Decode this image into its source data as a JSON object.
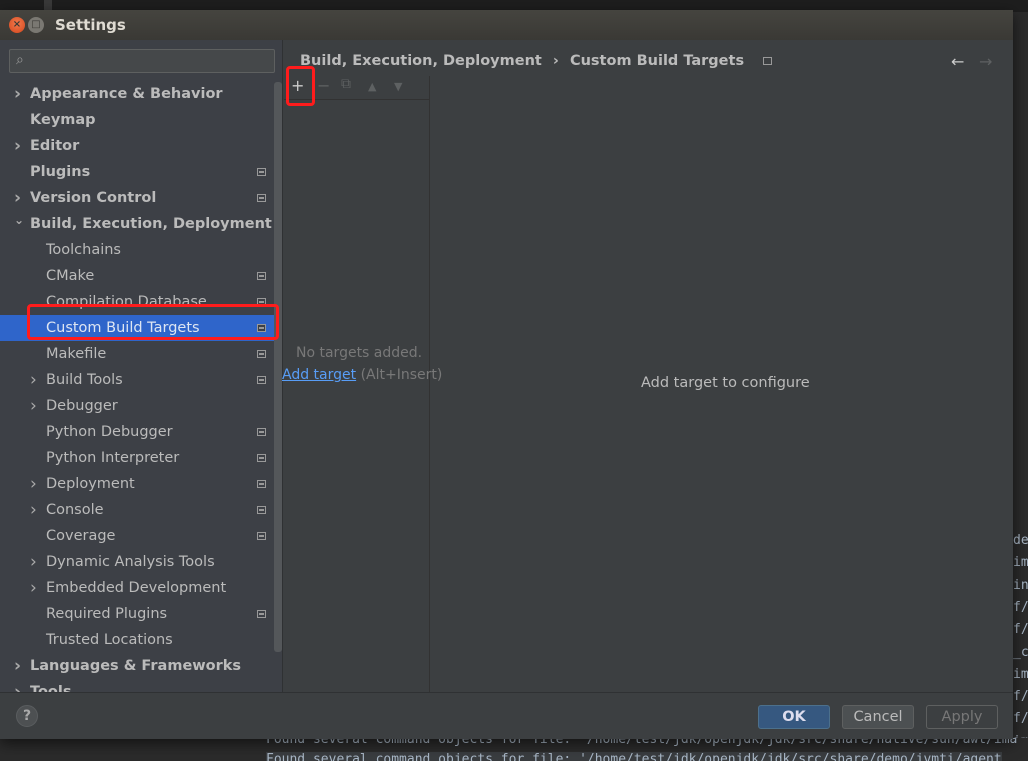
{
  "window": {
    "title": "Settings"
  },
  "search": {
    "placeholder": ""
  },
  "tree": [
    {
      "label": "Appearance & Behavior",
      "level": 0,
      "chevron": "right",
      "bold": true,
      "icon": false
    },
    {
      "label": "Keymap",
      "level": 0,
      "chevron": "none",
      "bold": true,
      "icon": false
    },
    {
      "label": "Editor",
      "level": 0,
      "chevron": "right",
      "bold": true,
      "icon": false
    },
    {
      "label": "Plugins",
      "level": 0,
      "chevron": "none",
      "bold": true,
      "icon": true
    },
    {
      "label": "Version Control",
      "level": 0,
      "chevron": "right",
      "bold": true,
      "icon": true
    },
    {
      "label": "Build, Execution, Deployment",
      "level": 0,
      "chevron": "down",
      "bold": true,
      "icon": false
    },
    {
      "label": "Toolchains",
      "level": 1,
      "chevron": "none",
      "icon": false
    },
    {
      "label": "CMake",
      "level": 1,
      "chevron": "none",
      "icon": true
    },
    {
      "label": "Compilation Database",
      "level": 1,
      "chevron": "none",
      "icon": true
    },
    {
      "label": "Custom Build Targets",
      "level": 1,
      "chevron": "none",
      "icon": true,
      "selected": true
    },
    {
      "label": "Makefile",
      "level": 1,
      "chevron": "none",
      "icon": true
    },
    {
      "label": "Build Tools",
      "level": 1,
      "chevron": "right",
      "icon": true
    },
    {
      "label": "Debugger",
      "level": 1,
      "chevron": "right",
      "icon": false
    },
    {
      "label": "Python Debugger",
      "level": 1,
      "chevron": "none",
      "icon": true
    },
    {
      "label": "Python Interpreter",
      "level": 1,
      "chevron": "none",
      "icon": true
    },
    {
      "label": "Deployment",
      "level": 1,
      "chevron": "right",
      "icon": true
    },
    {
      "label": "Console",
      "level": 1,
      "chevron": "right",
      "icon": true
    },
    {
      "label": "Coverage",
      "level": 1,
      "chevron": "none",
      "icon": true
    },
    {
      "label": "Dynamic Analysis Tools",
      "level": 1,
      "chevron": "right",
      "icon": false
    },
    {
      "label": "Embedded Development",
      "level": 1,
      "chevron": "right",
      "icon": false
    },
    {
      "label": "Required Plugins",
      "level": 1,
      "chevron": "none",
      "icon": true
    },
    {
      "label": "Trusted Locations",
      "level": 1,
      "chevron": "none",
      "icon": false
    },
    {
      "label": "Languages & Frameworks",
      "level": 0,
      "chevron": "right",
      "bold": true,
      "icon": false
    },
    {
      "label": "Tools",
      "level": 0,
      "chevron": "right",
      "bold": true,
      "icon": false
    }
  ],
  "breadcrumb": {
    "parent": "Build, Execution, Deployment",
    "separator": "›",
    "current": "Custom Build Targets"
  },
  "nav": {
    "back": "←",
    "forward": "→"
  },
  "toolbar": {
    "add": "+",
    "remove": "−",
    "copy": "⧉",
    "up": "▲",
    "down": "▼"
  },
  "targets": {
    "empty_text": "No targets added.",
    "add_link": "Add target",
    "shortcut": " (Alt+Insert)"
  },
  "detail": {
    "hint": "Add target to configure"
  },
  "footer": {
    "help": "?",
    "ok": "OK",
    "cancel": "Cancel",
    "apply": "Apply"
  },
  "background_terminal": {
    "right_fragments": [
      "del",
      "ima",
      "in",
      "f/",
      "f/",
      "_c",
      "ima",
      "f/",
      "f/",
      "ima"
    ],
    "bottom_lines": [
      "Found several command objects for file: '/home/test/jdk/openjdk/jdk/src/share/native/sun/awt/ima",
      "Found several command objects for file: '/home/test/jdk/openjdk/jdk/src/share/demo/jvmti/agent"
    ]
  },
  "colors": {
    "selection": "#2f65ca",
    "highlight_box": "#ff1c1c",
    "link": "#589df6",
    "ok_button": "#365880"
  }
}
